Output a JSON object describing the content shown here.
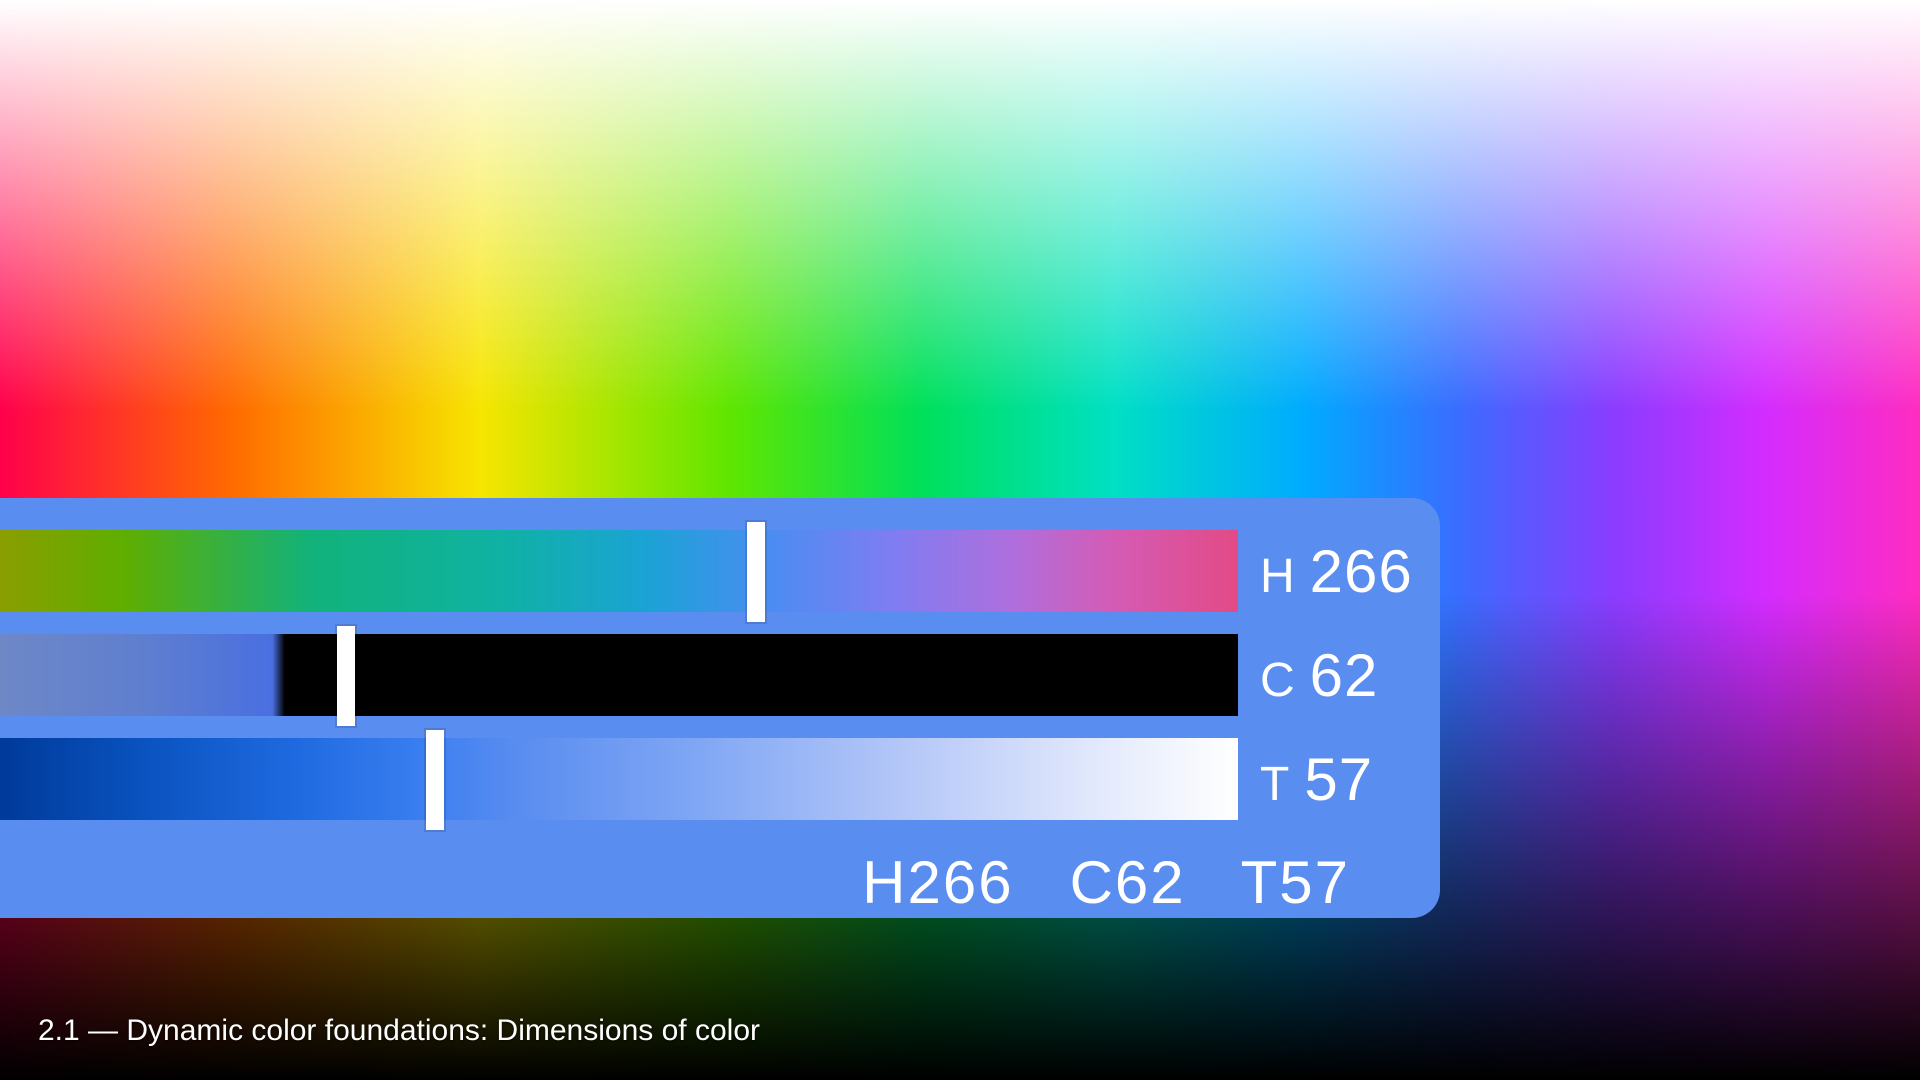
{
  "panel": {
    "hue": {
      "label": "H",
      "value": 266,
      "thumb_pct": 60.3
    },
    "chroma": {
      "label": "C",
      "value": 62,
      "thumb_pct": 27.2
    },
    "tone": {
      "label": "T",
      "value": 57,
      "thumb_pct": 34.4
    },
    "combined_parts": {
      "h": "H266",
      "c": "C62",
      "t": "T57"
    }
  },
  "caption": "2.1 — Dynamic color foundations: Dimensions of color",
  "colors": {
    "panel_bg": "#5a8df0",
    "thumb": "#ffffff",
    "text": "#ffffff"
  }
}
